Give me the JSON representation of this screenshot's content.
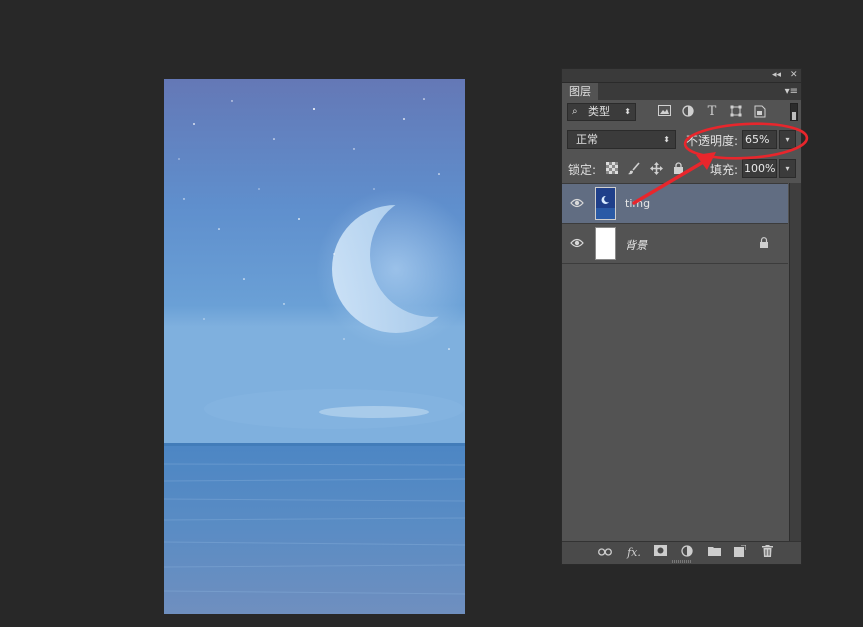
{
  "panel": {
    "tab_label": "图层",
    "collapse_glyph": "◂◂",
    "close_glyph": "✕",
    "menu_glyph": "▾≡"
  },
  "filter": {
    "kind_label": "类型",
    "icons": [
      "image-filter-icon",
      "adjustment-filter-icon",
      "type-filter-icon",
      "shape-filter-icon",
      "smart-object-filter-icon"
    ]
  },
  "blend": {
    "mode": "正常",
    "opacity_label": "不透明度:",
    "opacity_value": "65%"
  },
  "lock": {
    "label": "锁定:",
    "fill_label": "填充:",
    "fill_value": "100%"
  },
  "layers": [
    {
      "name": "timg",
      "visible": true,
      "selected": true
    },
    {
      "name": "背景",
      "visible": true,
      "selected": false,
      "locked": true
    }
  ],
  "bottom_icons": [
    "link-layers-icon",
    "fx-icon",
    "add-mask-icon",
    "adjustment-layer-icon",
    "new-group-icon",
    "new-layer-icon",
    "delete-layer-icon"
  ],
  "colors": {
    "app_bg": "#282828",
    "panel_bg": "#535353",
    "selected_row": "#616d82",
    "annotation_red": "#e8262c"
  }
}
